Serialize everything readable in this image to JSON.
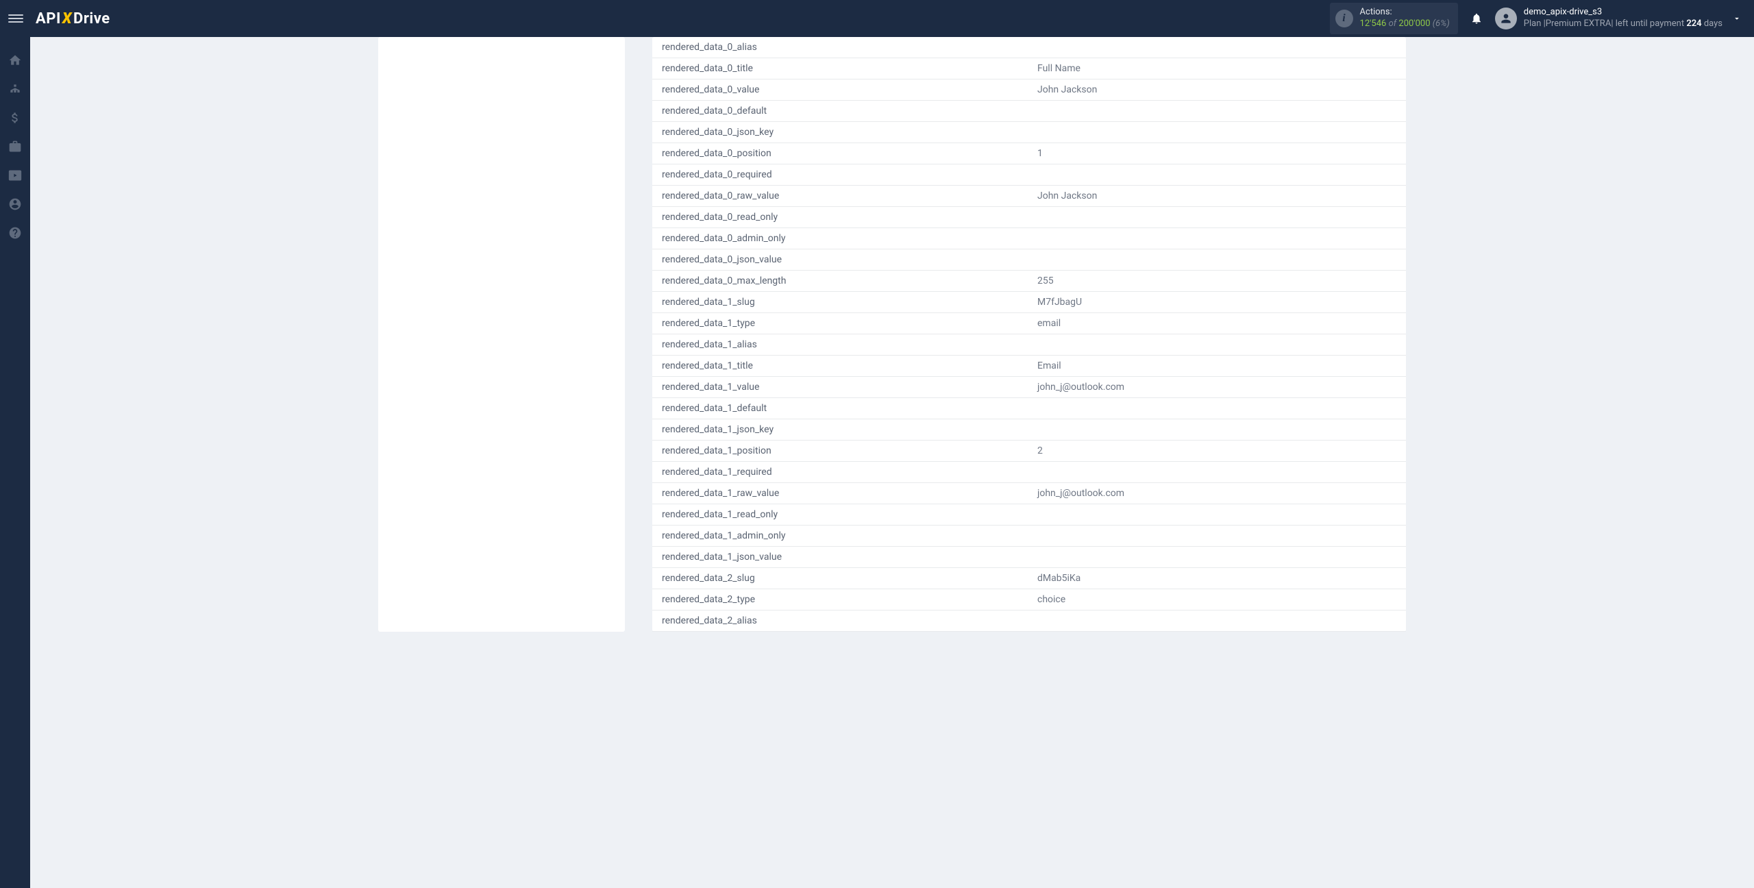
{
  "header": {
    "logo_parts": {
      "api": "API",
      "x": "X",
      "drive": "Drive"
    },
    "actions": {
      "label": "Actions:",
      "used": "12'546",
      "of": "of",
      "total": "200'000",
      "pct": "(6%)"
    },
    "user": {
      "name": "demo_apix-drive_s3",
      "plan_prefix": "Plan |",
      "plan_name": "Premium EXTRA",
      "plan_sep": "|",
      "left_text": " left until payment ",
      "days_num": "224",
      "days_word": " days"
    }
  },
  "rows": [
    {
      "k": "rendered_data_0_alias",
      "v": ""
    },
    {
      "k": "rendered_data_0_title",
      "v": "Full Name"
    },
    {
      "k": "rendered_data_0_value",
      "v": "John Jackson"
    },
    {
      "k": "rendered_data_0_default",
      "v": ""
    },
    {
      "k": "rendered_data_0_json_key",
      "v": ""
    },
    {
      "k": "rendered_data_0_position",
      "v": "1"
    },
    {
      "k": "rendered_data_0_required",
      "v": ""
    },
    {
      "k": "rendered_data_0_raw_value",
      "v": "John Jackson"
    },
    {
      "k": "rendered_data_0_read_only",
      "v": ""
    },
    {
      "k": "rendered_data_0_admin_only",
      "v": ""
    },
    {
      "k": "rendered_data_0_json_value",
      "v": ""
    },
    {
      "k": "rendered_data_0_max_length",
      "v": "255"
    },
    {
      "k": "rendered_data_1_slug",
      "v": "M7fJbagU"
    },
    {
      "k": "rendered_data_1_type",
      "v": "email"
    },
    {
      "k": "rendered_data_1_alias",
      "v": ""
    },
    {
      "k": "rendered_data_1_title",
      "v": "Email"
    },
    {
      "k": "rendered_data_1_value",
      "v": "john_j@outlook.com"
    },
    {
      "k": "rendered_data_1_default",
      "v": ""
    },
    {
      "k": "rendered_data_1_json_key",
      "v": ""
    },
    {
      "k": "rendered_data_1_position",
      "v": "2"
    },
    {
      "k": "rendered_data_1_required",
      "v": ""
    },
    {
      "k": "rendered_data_1_raw_value",
      "v": "john_j@outlook.com"
    },
    {
      "k": "rendered_data_1_read_only",
      "v": ""
    },
    {
      "k": "rendered_data_1_admin_only",
      "v": ""
    },
    {
      "k": "rendered_data_1_json_value",
      "v": ""
    },
    {
      "k": "rendered_data_2_slug",
      "v": "dMab5iKa"
    },
    {
      "k": "rendered_data_2_type",
      "v": "choice"
    },
    {
      "k": "rendered_data_2_alias",
      "v": ""
    }
  ]
}
